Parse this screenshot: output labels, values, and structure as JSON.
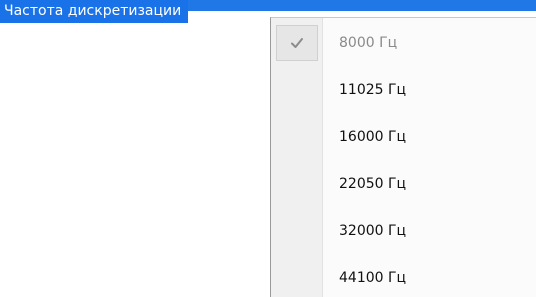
{
  "field": {
    "label": "Частота дискретизации"
  },
  "menu": {
    "items": [
      {
        "label": "8000 Гц",
        "checked": true,
        "disabled": true
      },
      {
        "label": "11025 Гц"
      },
      {
        "label": "16000 Гц"
      },
      {
        "label": "22050 Гц"
      },
      {
        "label": "32000 Гц"
      },
      {
        "label": "44100 Гц"
      }
    ],
    "check_icon": "checkmark-icon"
  },
  "colors": {
    "selection": "#1a72e8",
    "menu_background": "#fbfbfb",
    "gutter": "#f0f0f0",
    "disabled_text": "#8a8a8a"
  }
}
